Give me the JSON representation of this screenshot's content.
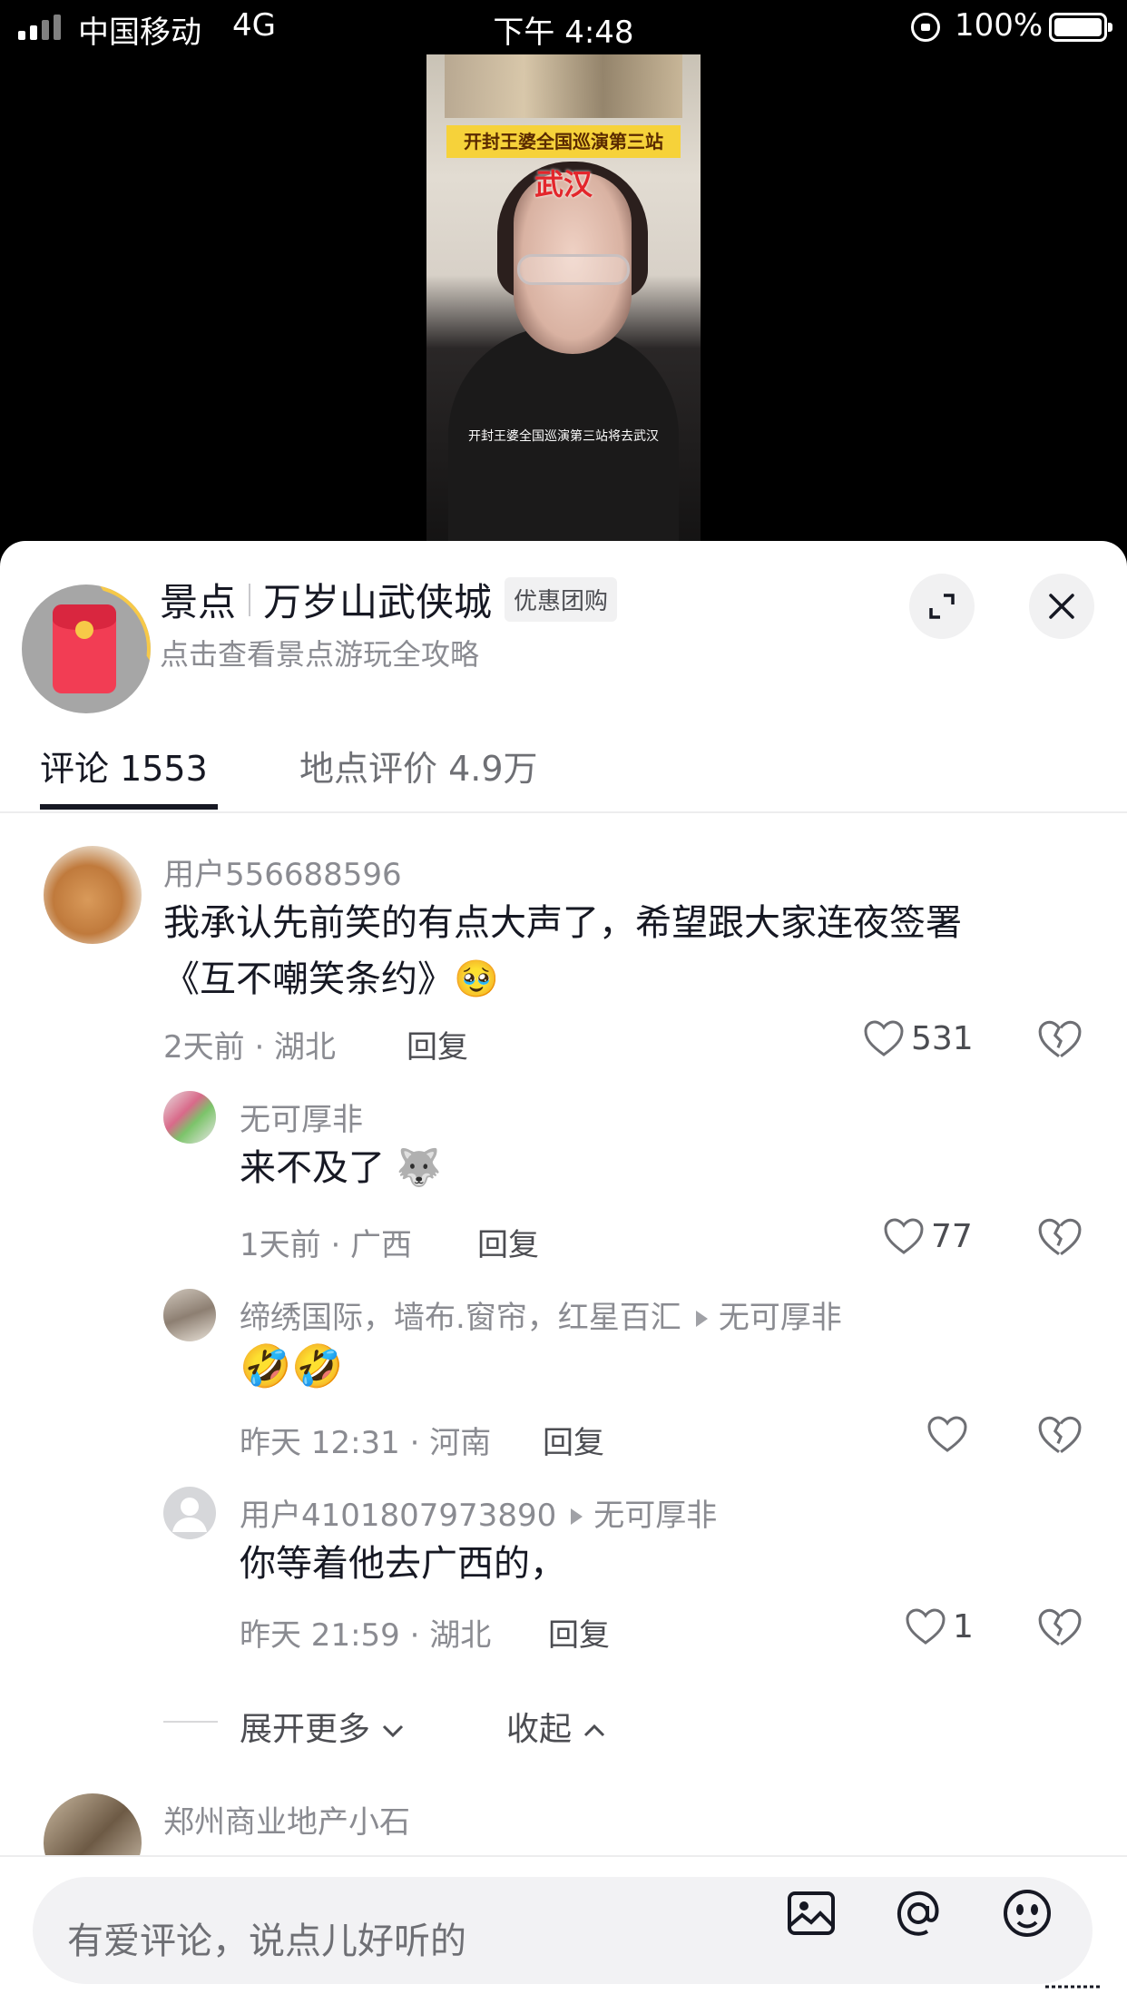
{
  "status_bar": {
    "carrier": "中国移动",
    "network": "4G",
    "time": "下午 4:48",
    "battery": "100%"
  },
  "video": {
    "banner": "开封王婆全国巡演第三站",
    "city": "武汉",
    "subtitle": "开封王婆全国巡演第三站将去武汉"
  },
  "poi": {
    "category": "景点",
    "name": "万岁山武侠城",
    "tag": "优惠团购",
    "subtitle": "点击查看景点游玩全攻略"
  },
  "tabs": [
    {
      "label": "评论 1553",
      "active": true
    },
    {
      "label": "地点评价 4.9万",
      "active": false
    }
  ],
  "comments": [
    {
      "user": "用户556688596",
      "text_line1": "我承认先前笑的有点大声了，希望跟大家连夜签署",
      "text_line2": "《互不嘲笑条约》",
      "emoji": "🥹",
      "meta": "2天前 · 湖北",
      "reply": "回复",
      "likes": "531"
    }
  ],
  "replies": [
    {
      "user": "无可厚非",
      "text": "来不及了",
      "emoji": "🐺",
      "meta": "1天前 · 广西",
      "reply": "回复",
      "likes": "77"
    },
    {
      "user": "缔绣国际，墙布.窗帘，红星百汇",
      "reply_to": "无可厚非",
      "text": "🤣🤣",
      "meta": "昨天 12:31 · 河南",
      "reply": "回复",
      "likes": ""
    },
    {
      "user": "用户4101807973890",
      "reply_to": "无可厚非",
      "text": "你等着他去广西的，",
      "meta": "昨天 21:59 · 湖北",
      "reply": "回复",
      "likes": "1"
    }
  ],
  "expand": {
    "more": "展开更多",
    "collapse": "收起"
  },
  "next_comment": {
    "user": "郑州商业地产小石"
  },
  "input": {
    "placeholder": "有爱评论，说点儿好听的"
  },
  "icons": [
    "expand-icon",
    "close-icon",
    "heart-icon",
    "broken-heart-icon",
    "image-icon",
    "at-icon",
    "emoji-icon"
  ]
}
